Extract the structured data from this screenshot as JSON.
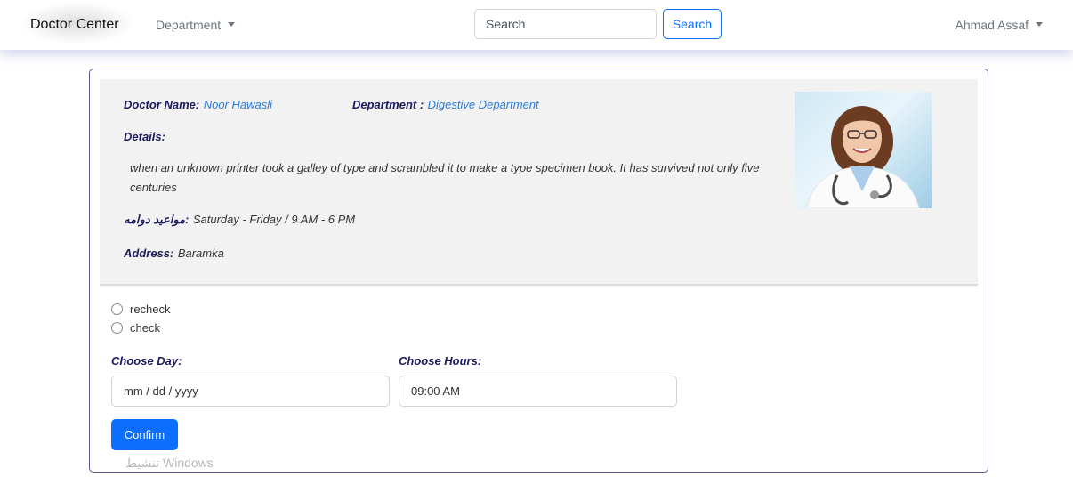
{
  "navbar": {
    "brand": "Doctor Center",
    "department_menu": "Department",
    "search_placeholder": "Search",
    "search_button": "Search",
    "user": "Ahmad Assaf"
  },
  "doctor": {
    "name_label": "Doctor Name:",
    "name": "Noor Hawasli",
    "department_label": "Department :",
    "department": "Digestive Department",
    "details_label": "Details:",
    "details": "when an unknown printer took a galley of type and scrambled it to make a type specimen book. It has survived not only five centuries",
    "hours_label": "مواعيد دوامه:",
    "hours": "Saturday - Friday / 9 AM - 6 PM",
    "address_label": "Address:",
    "address": "Baramka"
  },
  "booking": {
    "options": [
      "recheck",
      "check"
    ],
    "day_label": "Choose Day:",
    "day_value": "mm / dd / yyyy",
    "hours_label": "Choose Hours:",
    "hours_value": "09:00 AM",
    "confirm_button": "Confirm"
  },
  "watermark": "تنشيط Windows"
}
